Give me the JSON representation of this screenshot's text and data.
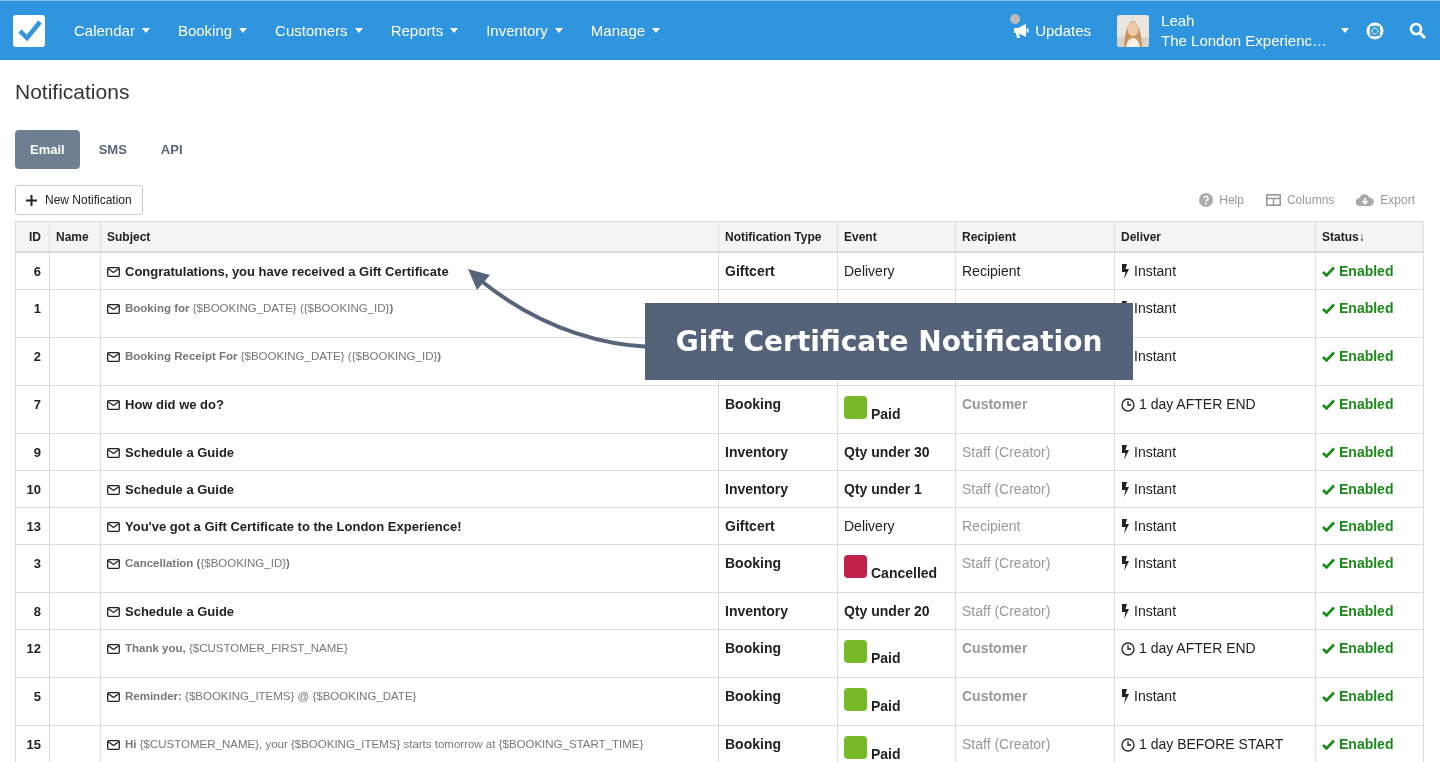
{
  "navbar": {
    "menu": [
      {
        "label": "Calendar"
      },
      {
        "label": "Booking"
      },
      {
        "label": "Customers"
      },
      {
        "label": "Reports"
      },
      {
        "label": "Inventory"
      },
      {
        "label": "Manage"
      }
    ],
    "updates": {
      "label": "Updates"
    },
    "user": {
      "name": "Leah",
      "org": "The London Experienc…"
    }
  },
  "page_title": "Notifications",
  "tabs": [
    {
      "label": "Email",
      "selected": true
    },
    {
      "label": "SMS",
      "selected": false
    },
    {
      "label": "API",
      "selected": false
    }
  ],
  "toolbar": {
    "new_button": "New Notification",
    "actions": [
      {
        "kind": "help",
        "label": "Help"
      },
      {
        "kind": "columns",
        "label": "Columns"
      },
      {
        "kind": "export",
        "label": "Export"
      }
    ]
  },
  "table": {
    "columns": [
      {
        "label": "ID"
      },
      {
        "label": "Name"
      },
      {
        "label": "Subject"
      },
      {
        "label": "Notification Type"
      },
      {
        "label": "Event"
      },
      {
        "label": "Recipient"
      },
      {
        "label": "Deliver"
      },
      {
        "label": "Status↓"
      }
    ],
    "rows": [
      {
        "id": "6",
        "subject": {
          "text": "Congratulations, you have received a Gift Certificate",
          "bold": true
        },
        "type": "Giftcert",
        "event": {
          "kind": "plain",
          "text": "Delivery",
          "bold": false
        },
        "recipient": {
          "text": "Recipient",
          "bold": false,
          "muted": false
        },
        "deliver": {
          "kind": "instant",
          "text": "Instant"
        },
        "status": "Enabled"
      },
      {
        "id": "1",
        "subject": {
          "text": "**Booking for** {$BOOKING_DATE} ({$BOOKING_ID}**)**",
          "bold": false
        },
        "deliver": {
          "kind": "instant",
          "text": "Instant"
        },
        "status": "Enabled"
      },
      {
        "id": "2",
        "subject": {
          "text": "**Booking Receipt For** {$BOOKING_DATE} ({$BOOKING_ID}**)**",
          "bold": false
        },
        "deliver": {
          "text": "Instant"
        },
        "status": "Enabled"
      },
      {
        "id": "7",
        "subject": {
          "text": "How did we do?",
          "bold": true
        },
        "type": "Booking",
        "event": {
          "kind": "badge",
          "text": "Paid",
          "color": "#77b928"
        },
        "recipient": {
          "text": "Customer",
          "bold": true,
          "muted": true
        },
        "deliver": {
          "kind": "scheduled",
          "text": "1 day AFTER END"
        },
        "status": "Enabled"
      },
      {
        "id": "9",
        "subject": {
          "text": "Schedule a Guide",
          "bold": true
        },
        "type": "Inventory",
        "event": {
          "kind": "plain",
          "text": "Qty under 30",
          "bold": true
        },
        "recipient": {
          "text": "Staff (Creator)",
          "bold": false,
          "muted": true
        },
        "deliver": {
          "kind": "instant",
          "text": "Instant"
        },
        "status": "Enabled"
      },
      {
        "id": "10",
        "subject": {
          "text": "Schedule a Guide",
          "bold": true
        },
        "type": "Inventory",
        "event": {
          "kind": "plain",
          "text": "Qty under 1",
          "bold": true
        },
        "recipient": {
          "text": "Staff (Creator)",
          "bold": false,
          "muted": true
        },
        "deliver": {
          "kind": "instant",
          "text": "Instant"
        },
        "status": "Enabled"
      },
      {
        "id": "13",
        "subject": {
          "text": "You've got a Gift Certificate to the London Experience!",
          "bold": true
        },
        "type": "Giftcert",
        "event": {
          "kind": "plain",
          "text": "Delivery",
          "bold": false
        },
        "recipient": {
          "text": "Recipient",
          "bold": false,
          "muted": true
        },
        "deliver": {
          "kind": "instant",
          "text": "Instant"
        },
        "status": "Enabled"
      },
      {
        "id": "3",
        "subject": {
          "text": "**Cancellation (**{$BOOKING_ID}**)**",
          "bold": false
        },
        "type": "Booking",
        "event": {
          "kind": "badge",
          "text": "Cancelled",
          "color": "#c0214a"
        },
        "recipient": {
          "text": "Staff (Creator)",
          "bold": false,
          "muted": true
        },
        "deliver": {
          "kind": "instant",
          "text": "Instant"
        },
        "status": "Enabled"
      },
      {
        "id": "8",
        "subject": {
          "text": "Schedule a Guide",
          "bold": true
        },
        "type": "Inventory",
        "event": {
          "kind": "plain",
          "text": "Qty under 20",
          "bold": true
        },
        "recipient": {
          "text": "Staff (Creator)",
          "bold": false,
          "muted": true
        },
        "deliver": {
          "kind": "instant",
          "text": "Instant"
        },
        "status": "Enabled"
      },
      {
        "id": "12",
        "subject": {
          "text": "**Thank you,** {$CUSTOMER_FIRST_NAME}",
          "bold": false
        },
        "type": "Booking",
        "event": {
          "kind": "badge",
          "text": "Paid",
          "color": "#77b928"
        },
        "recipient": {
          "text": "Customer",
          "bold": true,
          "muted": true
        },
        "deliver": {
          "kind": "scheduled",
          "text": "1 day AFTER END"
        },
        "status": "Enabled"
      },
      {
        "id": "5",
        "subject": {
          "text": "**Reminder:** {$BOOKING_ITEMS} @ {$BOOKING_DATE}",
          "bold": false
        },
        "type": "Booking",
        "event": {
          "kind": "badge",
          "text": "Paid",
          "color": "#77b928"
        },
        "recipient": {
          "text": "Customer",
          "bold": true,
          "muted": true
        },
        "deliver": {
          "kind": "instant",
          "text": "Instant"
        },
        "status": "Enabled"
      },
      {
        "id": "15",
        "subject": {
          "text": "**Hi** {$CUSTOMER_NAME}, your {$BOOKING_ITEMS} starts tomorrow at {$BOOKING_START_TIME}",
          "bold": false
        },
        "type": "Booking",
        "event": {
          "kind": "badge",
          "text": "Paid",
          "color": "#77b928"
        },
        "recipient": {
          "text": "Staff (Creator)",
          "bold": false,
          "muted": true
        },
        "deliver": {
          "kind": "scheduled",
          "text": "1 day BEFORE START"
        },
        "status": "Enabled"
      }
    ]
  },
  "callout": {
    "text": "Gift Certificate Notification"
  }
}
